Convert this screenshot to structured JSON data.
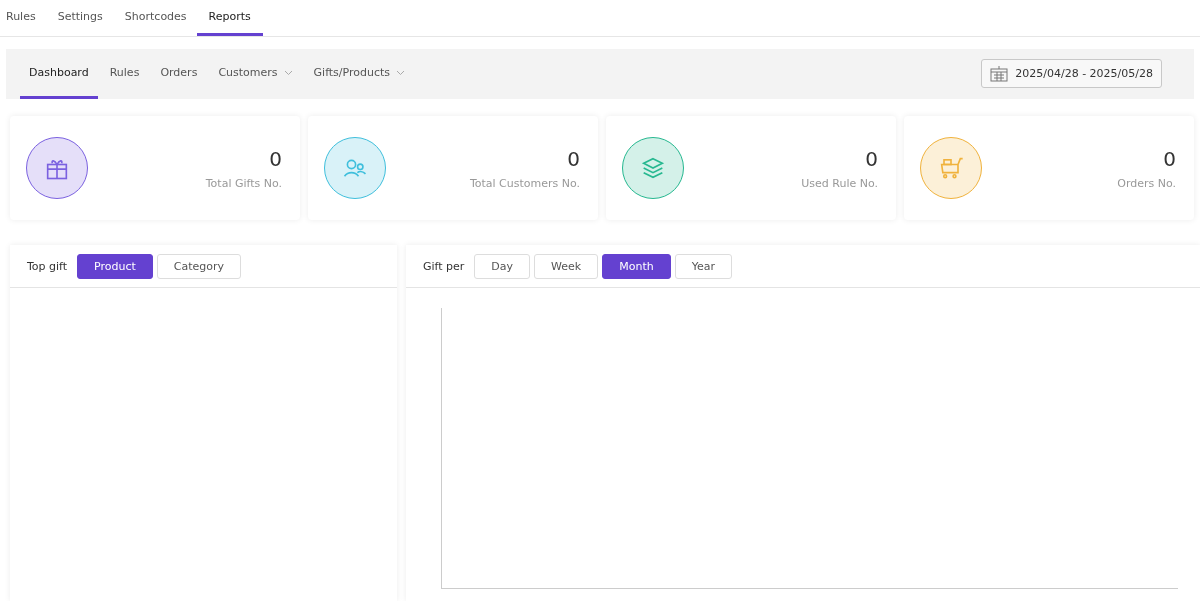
{
  "top_tabs": [
    {
      "label": "Rules",
      "selected": false
    },
    {
      "label": "Settings",
      "selected": false
    },
    {
      "label": "Shortcodes",
      "selected": false
    },
    {
      "label": "Reports",
      "selected": true
    }
  ],
  "sub_tabs": [
    {
      "label": "Dashboard",
      "selected": true,
      "dropdown": false
    },
    {
      "label": "Rules",
      "selected": false,
      "dropdown": false
    },
    {
      "label": "Orders",
      "selected": false,
      "dropdown": false
    },
    {
      "label": "Customers",
      "selected": false,
      "dropdown": true
    },
    {
      "label": "Gifts/Products",
      "selected": false,
      "dropdown": true
    }
  ],
  "date_range": "2025/04/28 - 2025/05/28",
  "stats": [
    {
      "kind": "gift",
      "color": "#7b61e0",
      "value": "0",
      "label": "Total Gifts No."
    },
    {
      "kind": "users",
      "color": "#3fbfdc",
      "value": "0",
      "label": "Total Customers No."
    },
    {
      "kind": "layers",
      "color": "#26b890",
      "value": "0",
      "label": "Used Rule No."
    },
    {
      "kind": "cart",
      "color": "#f0b23c",
      "value": "0",
      "label": "Orders No."
    }
  ],
  "top_gift": {
    "title": "Top gift",
    "options": [
      {
        "label": "Product",
        "selected": true
      },
      {
        "label": "Category",
        "selected": false
      }
    ]
  },
  "gift_per": {
    "title": "Gift per",
    "options": [
      {
        "label": "Day",
        "selected": false
      },
      {
        "label": "Week",
        "selected": false
      },
      {
        "label": "Month",
        "selected": true
      },
      {
        "label": "Year",
        "selected": false
      }
    ]
  }
}
